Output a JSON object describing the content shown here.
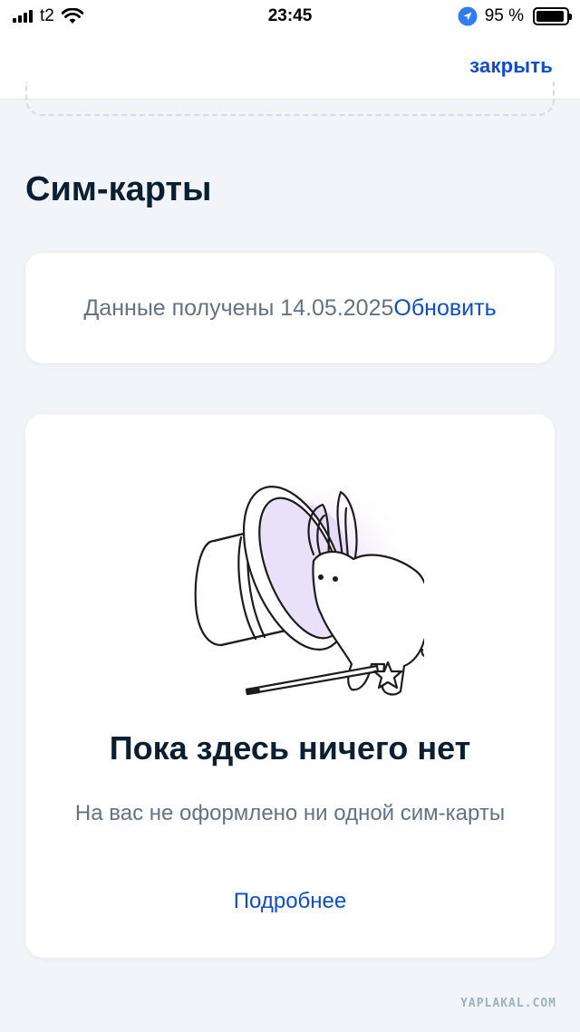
{
  "status_bar": {
    "carrier": "t2",
    "time": "23:45",
    "battery_text": "95 %",
    "battery_level": 0.95,
    "icons": [
      "signal-icon",
      "wifi-icon",
      "location-icon",
      "battery-icon"
    ]
  },
  "header": {
    "close_label": "закрыть"
  },
  "section": {
    "title": "Сим-карты"
  },
  "info_card": {
    "text": "Данные получены 14.05.2025",
    "refresh_label": "Обновить"
  },
  "empty_state": {
    "illustration": "magic-hat-rabbit-icon",
    "title": "Пока здесь ничего нет",
    "description": "На вас не оформлено ни одной сим-карты",
    "more_label": "Подробнее"
  },
  "watermark": "YAPLAKAL.COM",
  "colors": {
    "accent": "#0d4cd3",
    "background": "#f1f4f9",
    "text_primary": "#0b1f33",
    "text_secondary": "#66727f"
  }
}
